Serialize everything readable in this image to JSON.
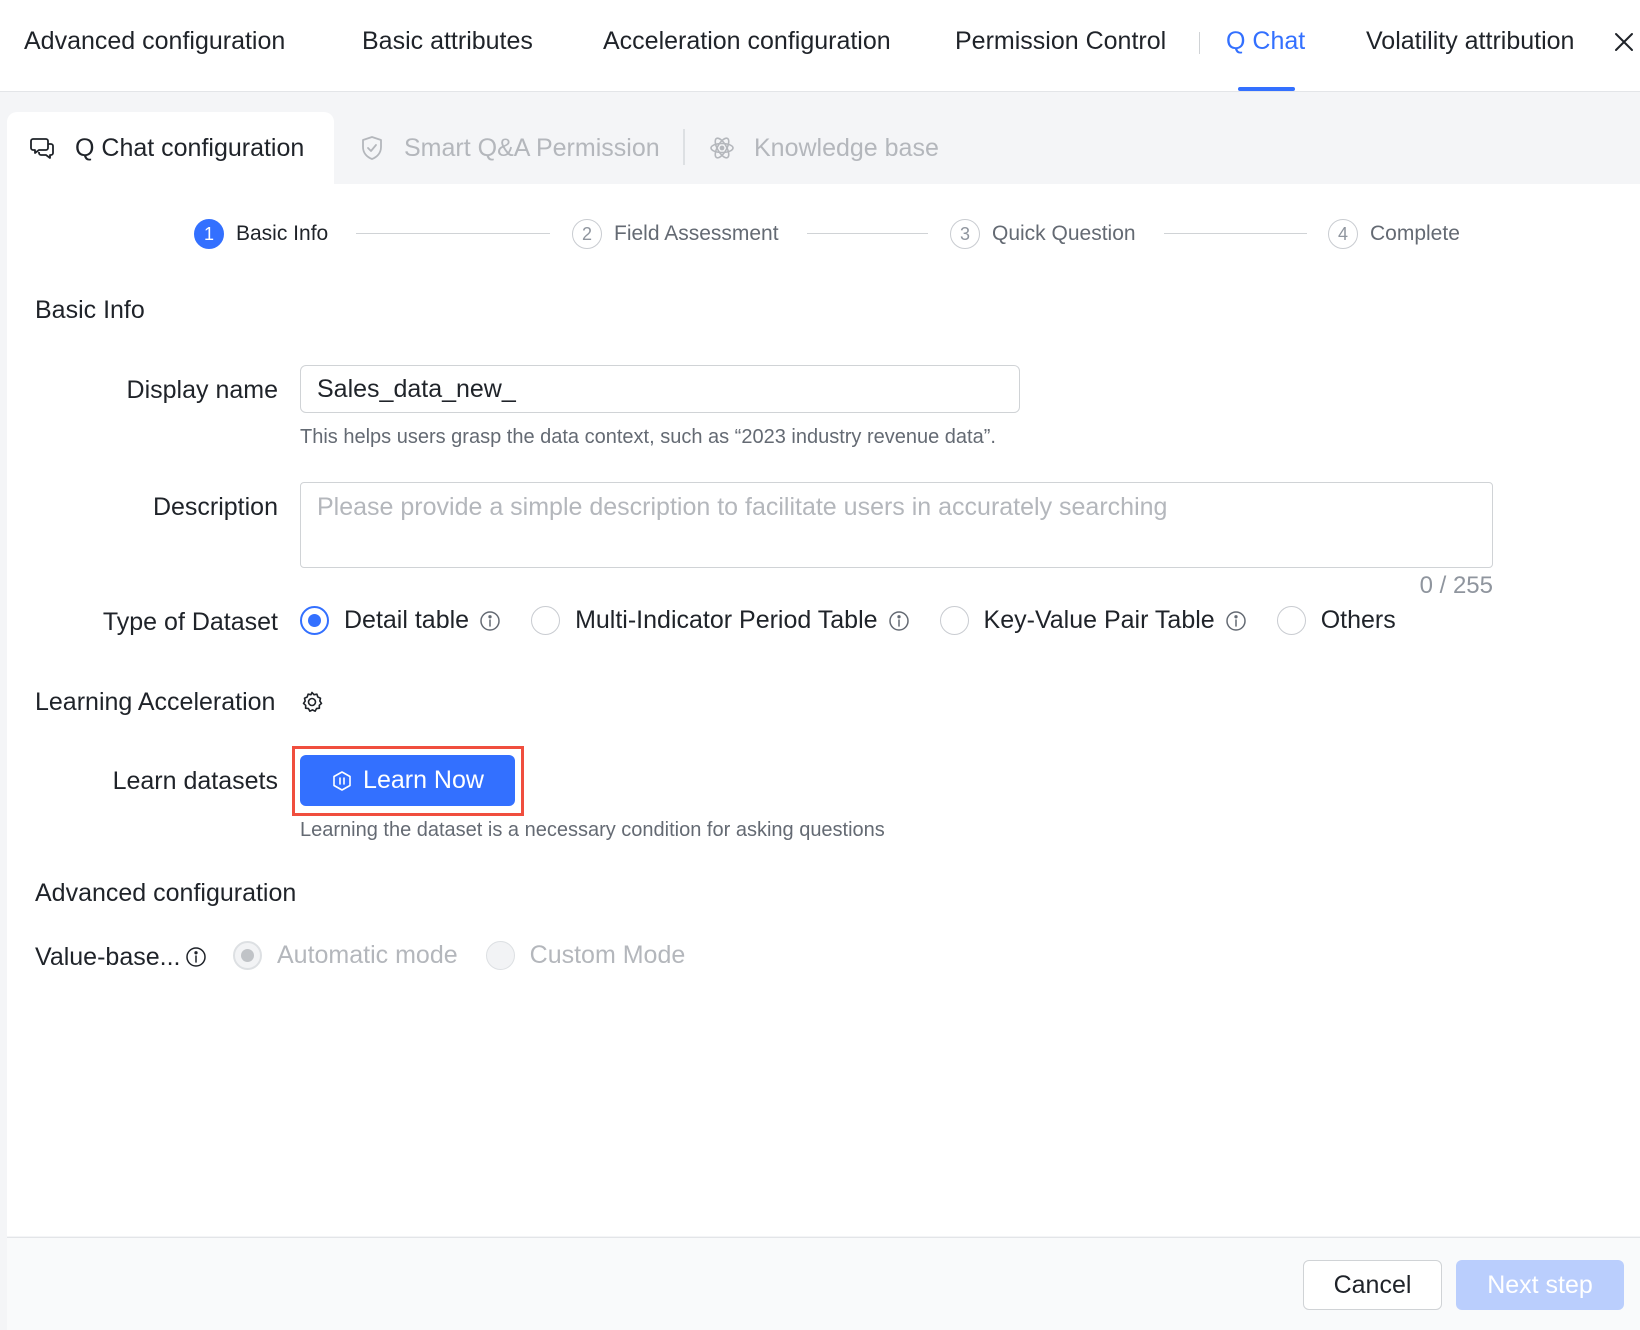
{
  "header": {
    "title": "Advanced configuration",
    "tabs": [
      {
        "label": "Basic attributes",
        "active": false
      },
      {
        "label": "Acceleration configuration",
        "active": false
      },
      {
        "label": "Permission Control",
        "active": false
      },
      {
        "label": "Q Chat",
        "active": true
      },
      {
        "label": "Volatility attribution",
        "active": false
      }
    ],
    "close_icon": "close-icon"
  },
  "subtabs": [
    {
      "label": "Q Chat configuration",
      "icon": "chat-icon",
      "active": true
    },
    {
      "label": "Smart Q&A Permission",
      "icon": "shield-check-icon",
      "active": false
    },
    {
      "label": "Knowledge base",
      "icon": "atom-icon",
      "active": false
    }
  ],
  "steps": [
    {
      "num": "1",
      "label": "Basic Info",
      "active": true
    },
    {
      "num": "2",
      "label": "Field Assessment",
      "active": false
    },
    {
      "num": "3",
      "label": "Quick Question",
      "active": false
    },
    {
      "num": "4",
      "label": "Complete",
      "active": false
    }
  ],
  "basic_info": {
    "section_title": "Basic Info",
    "display_name_label": "Display name",
    "display_name_value": "Sales_data_new_",
    "display_name_hint": "This helps users grasp the data context, such as “2023 industry revenue data”.",
    "description_label": "Description",
    "description_placeholder": "Please provide a simple description to facilitate users in accurately searching",
    "description_value": "",
    "description_counter": "0 / 255",
    "dataset_type_label": "Type of Dataset",
    "dataset_types": [
      {
        "label": "Detail table",
        "checked": true,
        "info": true
      },
      {
        "label": "Multi-Indicator Period Table",
        "checked": false,
        "info": true
      },
      {
        "label": "Key-Value Pair Table",
        "checked": false,
        "info": true
      },
      {
        "label": "Others",
        "checked": false,
        "info": false
      }
    ],
    "learning_acceleration_label": "Learning Acceleration",
    "learn_datasets_label": "Learn datasets",
    "learn_now_label": "Learn Now",
    "learn_hint": "Learning the dataset is a necessary condition for asking questions"
  },
  "advanced": {
    "section_title": "Advanced configuration",
    "value_based_label": "Value-base...",
    "modes": [
      {
        "label": "Automatic mode",
        "checked": true
      },
      {
        "label": "Custom Mode",
        "checked": false
      }
    ]
  },
  "footer": {
    "cancel_label": "Cancel",
    "next_label": "Next step"
  },
  "colors": {
    "accent": "#3370ff",
    "highlight_border": "#f04e3e",
    "disabled_button": "#bacefd"
  }
}
